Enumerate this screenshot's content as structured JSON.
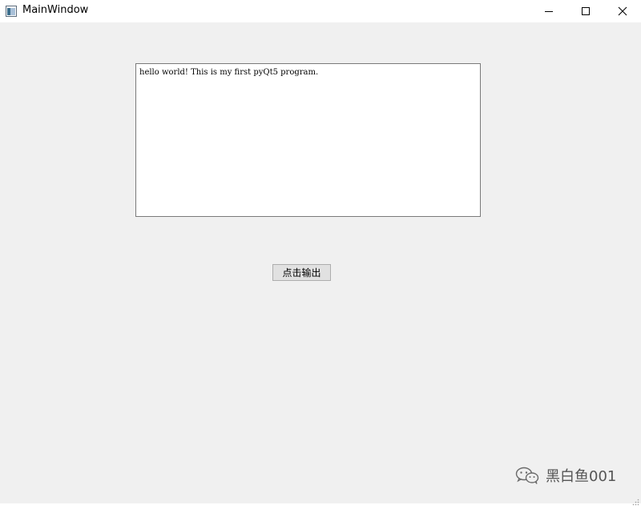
{
  "window": {
    "title": "MainWindow"
  },
  "titlebar": {
    "app_icon": "window-icon",
    "minimize_icon": "minimize-icon",
    "maximize_icon": "maximize-icon",
    "close_icon": "close-icon"
  },
  "main": {
    "text_edit_value": "hello world! This is my first pyQt5 program.",
    "button_label": "点击输出"
  },
  "watermark": {
    "icon": "wechat-icon",
    "text": "黑白鱼001"
  },
  "colors": {
    "window_bg": "#f0f0f0",
    "titlebar_bg": "#ffffff",
    "button_bg": "#e1e1e1",
    "text_edit_border": "#7a7a7a"
  }
}
